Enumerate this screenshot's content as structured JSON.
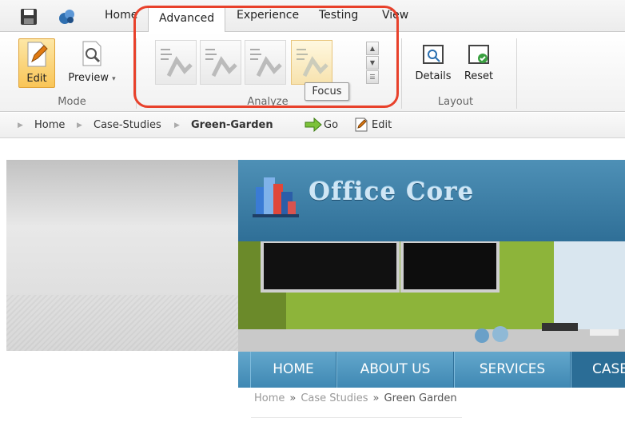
{
  "tabs": [
    "Home",
    "Advanced",
    "Experience",
    "Testing",
    "View"
  ],
  "active_tab": "Advanced",
  "ribbon": {
    "mode": {
      "label": "Mode",
      "edit": "Edit",
      "preview": "Preview"
    },
    "analyze": {
      "label": "Analyze",
      "tooltip": "Focus"
    },
    "layout": {
      "label": "Layout",
      "details": "Details",
      "reset": "Reset"
    }
  },
  "breadcrumb": {
    "items": [
      "Home",
      "Case-Studies",
      "Green-Garden"
    ],
    "go": "Go",
    "edit": "Edit"
  },
  "site": {
    "logo_text": "Office Core",
    "nav": [
      "HOME",
      "ABOUT US",
      "SERVICES",
      "CASE"
    ],
    "crumb": [
      "Home",
      "Case Studies",
      "Green Garden"
    ],
    "crumb_sep": "»"
  },
  "colors": {
    "highlight": "#e8412b",
    "accent": "#f9c557",
    "site_blue": "#3f88b3"
  }
}
